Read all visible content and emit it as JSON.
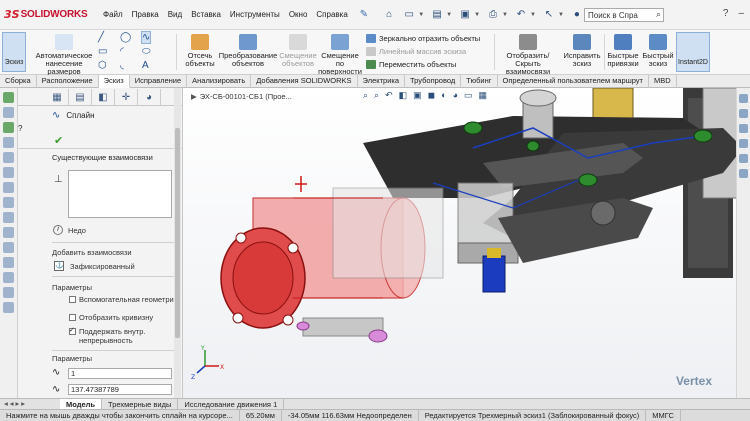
{
  "app": {
    "logo": "SOLIDWORKS",
    "logo_mark": "3S"
  },
  "menu": [
    "Файл",
    "Правка",
    "Вид",
    "Вставка",
    "Инструменты",
    "Окно",
    "Справка"
  ],
  "search": {
    "placeholder": "Поиск в Спра"
  },
  "ribbon": {
    "sketch": "Эскиз",
    "auto_dims": "Автоматическое нанесение размеров",
    "trim": "Отсечь объекты",
    "convert": "Преобразование объектов",
    "offset": "Смещение объектов",
    "offset_surface": "Смещение по поверхности",
    "mirror": "Зеркально отразить объекты",
    "linear_array": "Линейный массив эскиза",
    "move": "Переместить объекты",
    "show_hide": "Отобразить/Скрыть взаимосвязи",
    "repair": "Исправить эскиз",
    "quick_snaps": "Быстрые привязки",
    "rapid_sketch": "Быстрый эскиз",
    "instant2d": "Instant2D"
  },
  "tabs": [
    "Сборка",
    "Расположение",
    "Эскиз",
    "Исправление",
    "Анализировать",
    "Добавления SOLIDWORKS",
    "Электрика",
    "Трубопровод",
    "Тюбинг",
    "Определенный пользователем маршрут",
    "MBD"
  ],
  "active_tab": "Эскиз",
  "pm": {
    "title": "Сплайн",
    "existing_relations": "Существующие взаимосвязи",
    "info": "Недо",
    "add_relations": "Добавить взаимосвязи",
    "fixed": "Зафиксированный",
    "params1": "Параметры",
    "opt1": "Вспомогательная геометрия",
    "opt2": "Отобразить кривизну",
    "opt3": "Поддержать внутр. непрерывность",
    "params2": "Параметры",
    "val1": "1",
    "val2": "137.47387789"
  },
  "viewport": {
    "breadcrumb": "ЭХ-СБ-00101-СБ1 (Прое...",
    "watermark": "Vertex"
  },
  "bottom_tabs": [
    "Модель",
    "Трехмерные виды",
    "Исследование движения 1"
  ],
  "active_bottom_tab": "Модель",
  "status": [
    "Нажмите на мышь дважды чтобы закончить сплайн на курсоре...",
    "65.20мм",
    "-34.05мм 116.63мм Недоопределен",
    "Редактируется Трехмерный эскиз1 (Заблокированный фокус)",
    "ММГС"
  ]
}
